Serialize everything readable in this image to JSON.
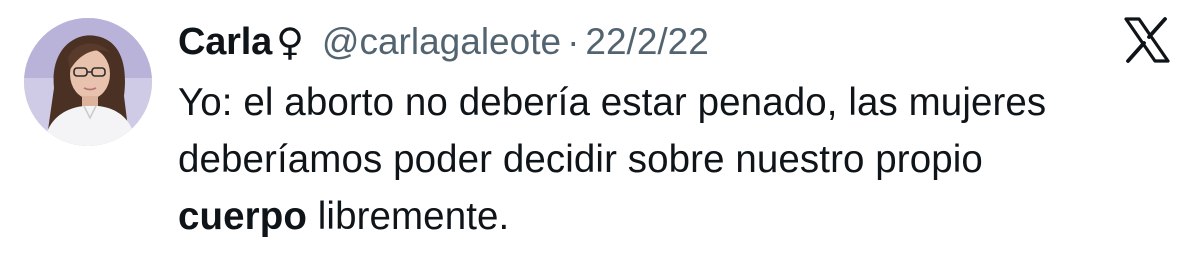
{
  "tweet": {
    "author": {
      "display_name": "Carla",
      "badge_icon": "female-sign-icon",
      "badge_glyph": "♀",
      "handle": "@carlagaleote"
    },
    "separator": "·",
    "date": "22/2/22",
    "platform_icon": "x-logo-icon",
    "text": {
      "line1": "Yo: el aborto no debería estar penado, las mujeres",
      "line2": "deberíamos poder decidir sobre nuestro propio",
      "line3_bold": "cuerpo",
      "line3_rest": " libremente."
    }
  },
  "colors": {
    "text_primary": "#0f1419",
    "text_secondary": "#536471",
    "background": "#ffffff"
  }
}
